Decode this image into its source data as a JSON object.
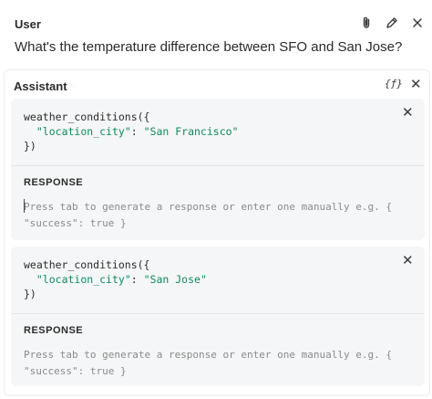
{
  "user": {
    "label": "User",
    "message": "What's the temperature difference between SFO and San Jose?",
    "icons": [
      "paperclip-icon",
      "pencil-icon",
      "close-icon"
    ]
  },
  "assistant": {
    "label": "Assistant",
    "fn_icon": "{ƒ}",
    "close_glyph": "✕",
    "tool_calls": [
      {
        "function": "weather_conditions",
        "arg_key": "location_city",
        "arg_value": "San Francisco",
        "response_label": "RESPONSE",
        "response_placeholder": "Press tab to generate a response or enter one manually e.g. {\n\"success\": true }"
      },
      {
        "function": "weather_conditions",
        "arg_key": "location_city",
        "arg_value": "San Jose",
        "response_label": "RESPONSE",
        "response_placeholder": "Press tab to generate a response or enter one manually e.g. {\n\"success\": true }"
      }
    ]
  },
  "colors": {
    "accent_green": "#0d8a5c",
    "card_bg": "#f5f6f7",
    "placeholder": "#8a8a8a"
  }
}
